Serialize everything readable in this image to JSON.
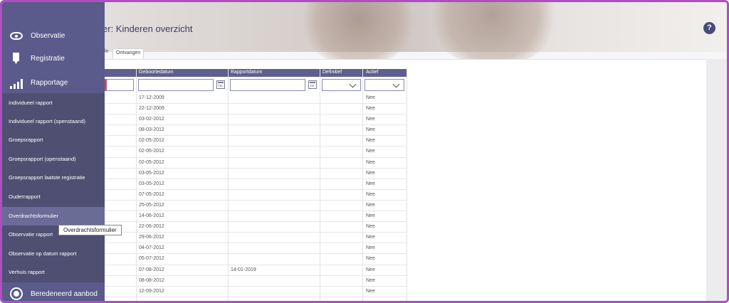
{
  "page": {
    "title_partial": "ulier: Kinderen overzicht",
    "help_label": "?"
  },
  "tabs": [
    {
      "label": "le"
    },
    {
      "label": "Ontvangen"
    }
  ],
  "sidebar": {
    "main_items": [
      {
        "label": "Observatie",
        "icon": "eye-icon"
      },
      {
        "label": "Registratie",
        "icon": "pen-icon"
      },
      {
        "label": "Rapportage",
        "icon": "bar-chart-icon"
      }
    ],
    "sub_items": [
      {
        "label": "Individueel rapport"
      },
      {
        "label": "Individueel rapport (openstaand)"
      },
      {
        "label": "Groepsrapport"
      },
      {
        "label": "Groepsrapport (openstaand)"
      },
      {
        "label": "Groepsrapport laatste registratie"
      },
      {
        "label": "Ouderrapport"
      },
      {
        "label": "Overdrachtsformulier"
      },
      {
        "label": "Observatie rapport"
      },
      {
        "label": "Observatie op datum rapport"
      },
      {
        "label": "Verhuis rapport"
      }
    ],
    "bottom_item": {
      "label": "Beredeneerd aanbod",
      "icon": "target-icon"
    }
  },
  "tooltip": {
    "text": "Overdrachtsformulier"
  },
  "table": {
    "columns": [
      "Geboortedatum",
      "Rapportdatum",
      "Definitief",
      "Actief"
    ],
    "rows": [
      {
        "geboortedatum": "17-12-2009",
        "rapportdatum": "",
        "actief": "Nee"
      },
      {
        "geboortedatum": "22-12-2009",
        "rapportdatum": "",
        "actief": "Nee"
      },
      {
        "geboortedatum": "03-02-2012",
        "rapportdatum": "",
        "actief": "Nee"
      },
      {
        "geboortedatum": "08-03-2012",
        "rapportdatum": "",
        "actief": "Nee"
      },
      {
        "geboortedatum": "02-05-2012",
        "rapportdatum": "",
        "actief": "Nee"
      },
      {
        "geboortedatum": "02-05-2012",
        "rapportdatum": "",
        "actief": "Nee"
      },
      {
        "geboortedatum": "02-05-2012",
        "rapportdatum": "",
        "actief": "Nee"
      },
      {
        "geboortedatum": "03-05-2012",
        "rapportdatum": "",
        "actief": "Nee"
      },
      {
        "geboortedatum": "03-05-2012",
        "rapportdatum": "",
        "actief": "Nee"
      },
      {
        "geboortedatum": "07-05-2012",
        "rapportdatum": "",
        "actief": "Nee"
      },
      {
        "geboortedatum": "25-05-2012",
        "rapportdatum": "",
        "actief": "Nee"
      },
      {
        "geboortedatum": "14-06-2012",
        "rapportdatum": "",
        "actief": "Nee"
      },
      {
        "geboortedatum": "22-06-2012",
        "rapportdatum": "",
        "actief": "Nee"
      },
      {
        "geboortedatum": "29-06-2012",
        "rapportdatum": "",
        "actief": "Nee"
      },
      {
        "geboortedatum": "04-07-2012",
        "rapportdatum": "",
        "actief": "Nee"
      },
      {
        "geboortedatum": "05-07-2012",
        "rapportdatum": "",
        "actief": "Nee"
      },
      {
        "geboortedatum": "07-08-2012",
        "rapportdatum": "14-01-2019",
        "actief": "Nee"
      },
      {
        "geboortedatum": "08-08-2012",
        "rapportdatum": "",
        "actief": "Nee"
      },
      {
        "geboortedatum": "12-09-2012",
        "rapportdatum": "",
        "actief": "Nee"
      }
    ]
  },
  "colors": {
    "sidebar": "#5a5b8a",
    "submenu": "#4f4f72",
    "table_header": "#5e5f8c",
    "frame_border": "#b04dc0",
    "filter_accent": "#c84b62"
  }
}
